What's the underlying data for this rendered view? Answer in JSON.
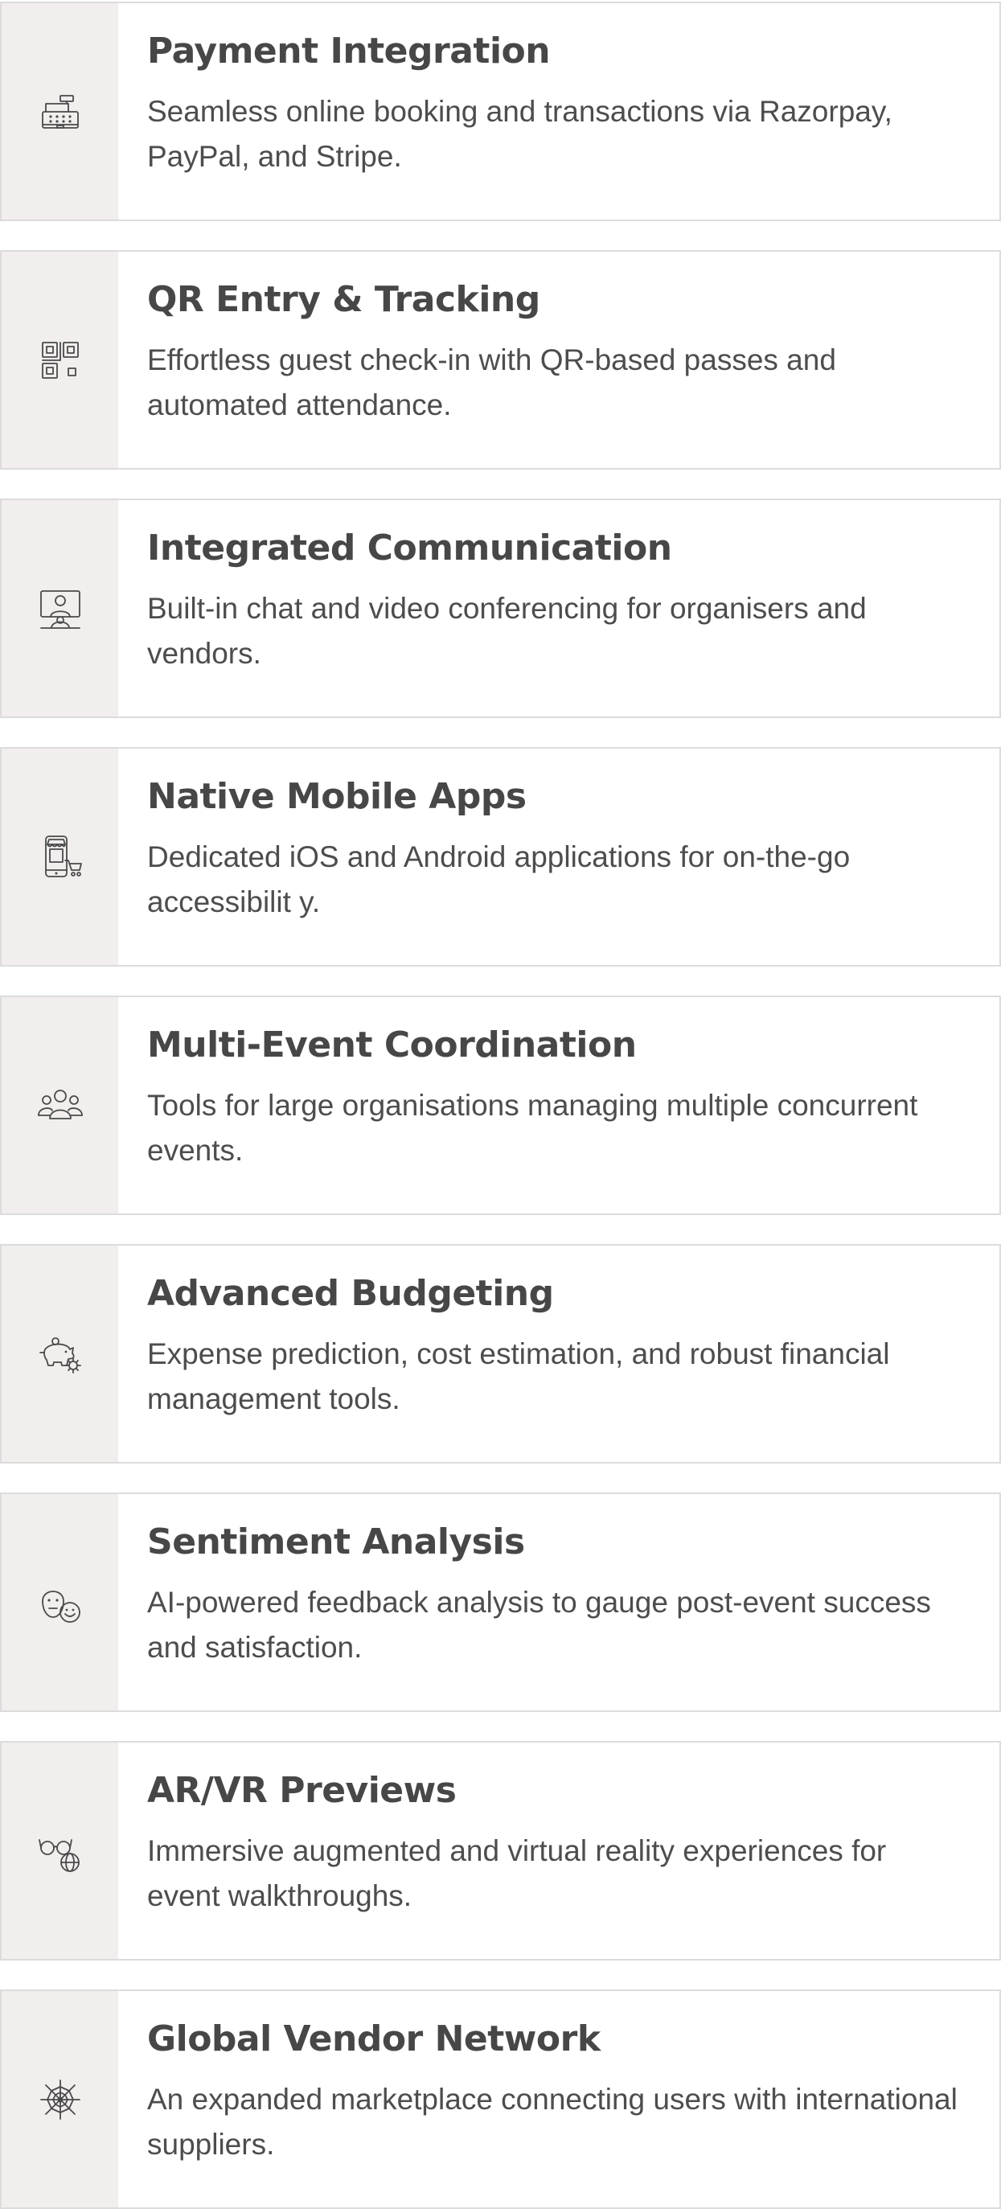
{
  "features": [
    {
      "icon": "cash-register-icon",
      "title": "Payment Integration",
      "description": "Seamless online booking and transactions via Razorpay, PayPal, and Stripe."
    },
    {
      "icon": "qr-code-icon",
      "title": "QR Entry & Tracking",
      "description": "Effortless guest check-in with QR-based passes and automated attendance."
    },
    {
      "icon": "video-conference-icon",
      "title": "Integrated Communication",
      "description": "Built-in chat and video conferencing for organisers and vendors."
    },
    {
      "icon": "mobile-shop-icon",
      "title": "Native Mobile Apps",
      "description": "Dedicated iOS and Android applications for on-the-go accessibilit y."
    },
    {
      "icon": "group-icon",
      "title": "Multi-Event Coordination",
      "description": "Tools for large organisations managing multiple concurrent events."
    },
    {
      "icon": "piggy-bank-gear-icon",
      "title": "Advanced Budgeting",
      "description": "Expense prediction, cost estimation, and robust financial management tools."
    },
    {
      "icon": "smiley-faces-icon",
      "title": "Sentiment Analysis",
      "description": "AI-powered feedback analysis to gauge post-event success and satisfaction."
    },
    {
      "icon": "glasses-globe-icon",
      "title": "AR/VR Previews",
      "description": "Immersive augmented and virtual reality experiences for event walkthroughs."
    },
    {
      "icon": "spider-web-icon",
      "title": "Global Vendor Network",
      "description": "An expanded marketplace connecting users with international suppliers."
    }
  ]
}
